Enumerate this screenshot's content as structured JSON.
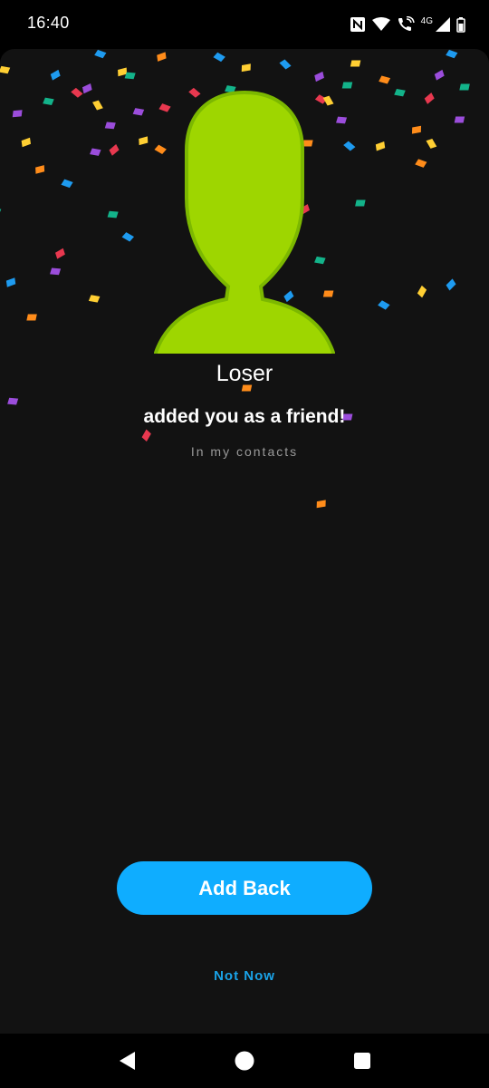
{
  "status_bar": {
    "time": "16:40",
    "network_label": "4G",
    "icons": [
      "nfc-icon",
      "wifi-icon",
      "wifi-calling-icon",
      "cell-signal-icon",
      "battery-icon"
    ]
  },
  "friend": {
    "name": "Loser",
    "message": "added you as a friend!",
    "source": "In my contacts",
    "avatar_icon": "user-silhouette-icon"
  },
  "actions": {
    "add_back_label": "Add Back",
    "not_now_label": "Not Now"
  },
  "nav": {
    "icons": [
      "back-icon",
      "home-icon",
      "recents-icon"
    ]
  },
  "colors": {
    "background": "#121212",
    "avatar_fill": "#9ed600",
    "avatar_outline": "#7cb800",
    "button": "#0fadff",
    "link": "#1aa3e8",
    "confetti": [
      "#e8384f",
      "#ffcf33",
      "#1e9bf0",
      "#9b4ddb",
      "#13b38a",
      "#ff8c1a"
    ]
  }
}
